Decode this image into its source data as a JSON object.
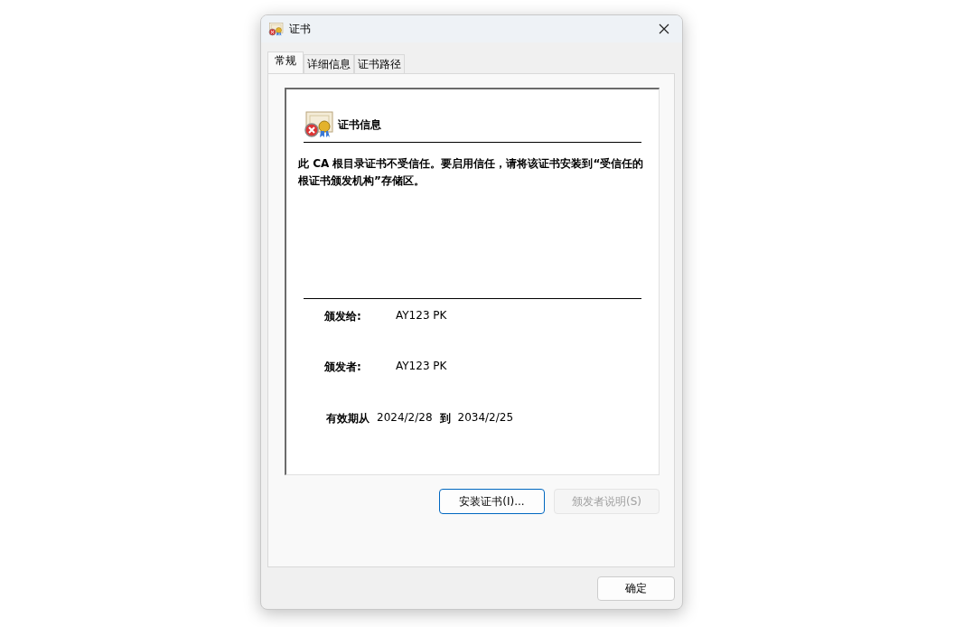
{
  "window": {
    "title": "证书"
  },
  "tabs": [
    {
      "label": "常规",
      "selected": true
    },
    {
      "label": "详细信息",
      "selected": false
    },
    {
      "label": "证书路径",
      "selected": false
    }
  ],
  "panel": {
    "heading": "证书信息",
    "message": "此 CA 根目录证书不受信任。要启用信任，请将该证书安装到“受信任的根证书颁发机构”存储区。",
    "fields": [
      {
        "label": "颁发给:",
        "value": "AY123 PK"
      },
      {
        "label": "颁发者:",
        "value": "AY123 PK"
      }
    ],
    "validity": {
      "label": "有效期从",
      "from": "2024/2/28",
      "to_label": "到",
      "to": "2034/2/25"
    }
  },
  "buttons": [
    {
      "label": "安装证书(I)...",
      "disabled": false
    },
    {
      "label": "颁发者说明(S)",
      "disabled": true
    }
  ],
  "ok_button": {
    "label": "确定"
  }
}
